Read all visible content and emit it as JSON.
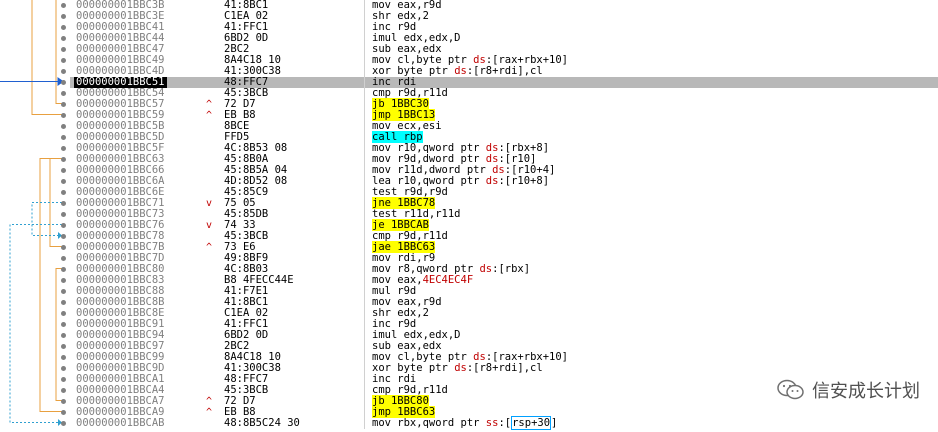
{
  "rows": [
    {
      "addr": "000000001BBC3B",
      "arrow": "",
      "bytes": "41:8BC1",
      "instr": [
        {
          "t": "mov eax,r9d"
        }
      ]
    },
    {
      "addr": "000000001BBC3E",
      "arrow": "",
      "bytes": "C1EA 02",
      "instr": [
        {
          "t": "shr edx,2"
        }
      ]
    },
    {
      "addr": "000000001BBC41",
      "arrow": "",
      "bytes": "41:FFC1",
      "instr": [
        {
          "t": "inc r9d"
        }
      ]
    },
    {
      "addr": "000000001BBC44",
      "arrow": "",
      "bytes": "6BD2 0D",
      "instr": [
        {
          "t": "imul edx,edx,D"
        }
      ]
    },
    {
      "addr": "000000001BBC47",
      "arrow": "",
      "bytes": "2BC2",
      "instr": [
        {
          "t": "sub eax,edx"
        }
      ]
    },
    {
      "addr": "000000001BBC49",
      "arrow": "",
      "bytes": "8A4C18 10",
      "instr": [
        {
          "t": "mov cl,byte ptr "
        },
        {
          "t": "ds",
          "c": "seg"
        },
        {
          "t": ":[rax+rbx+10]"
        }
      ]
    },
    {
      "addr": "000000001BBC4D",
      "arrow": "",
      "bytes": "41:300C38",
      "instr": [
        {
          "t": "xor byte ptr "
        },
        {
          "t": "ds",
          "c": "seg"
        },
        {
          "t": ":[r8+rdi],cl"
        }
      ]
    },
    {
      "addr": "000000001BBC51",
      "arrow": "",
      "bytes": "48:FFC7",
      "instr": [
        {
          "t": "inc rdi"
        }
      ],
      "sel": true,
      "ip": true
    },
    {
      "addr": "000000001BBC54",
      "arrow": "",
      "bytes": "45:3BCB",
      "instr": [
        {
          "t": "cmp r9d,r11d"
        }
      ]
    },
    {
      "addr": "000000001BBC57",
      "arrow": "^",
      "bytes": "72 D7",
      "instr": [
        {
          "t": "jb 1BBC30",
          "c": "hl-y"
        }
      ]
    },
    {
      "addr": "000000001BBC59",
      "arrow": "^",
      "bytes": "EB B8",
      "instr": [
        {
          "t": "jmp 1BBC13",
          "c": "hl-y"
        }
      ]
    },
    {
      "addr": "000000001BBC5B",
      "arrow": "",
      "bytes": "8BCE",
      "instr": [
        {
          "t": "mov ecx,esi"
        }
      ]
    },
    {
      "addr": "000000001BBC5D",
      "arrow": "",
      "bytes": "FFD5",
      "instr": [
        {
          "t": "call rbp",
          "c": "hl-c"
        }
      ]
    },
    {
      "addr": "000000001BBC5F",
      "arrow": "",
      "bytes": "4C:8B53 08",
      "instr": [
        {
          "t": "mov r10,qword ptr "
        },
        {
          "t": "ds",
          "c": "seg"
        },
        {
          "t": ":[rbx+8]"
        }
      ]
    },
    {
      "addr": "000000001BBC63",
      "arrow": "",
      "bytes": "45:8B0A",
      "instr": [
        {
          "t": "mov r9d,dword ptr "
        },
        {
          "t": "ds",
          "c": "seg"
        },
        {
          "t": ":[r10]"
        }
      ]
    },
    {
      "addr": "000000001BBC66",
      "arrow": "",
      "bytes": "45:8B5A 04",
      "instr": [
        {
          "t": "mov r11d,dword ptr "
        },
        {
          "t": "ds",
          "c": "seg"
        },
        {
          "t": ":[r10+4]"
        }
      ]
    },
    {
      "addr": "000000001BBC6A",
      "arrow": "",
      "bytes": "4D:8D52 08",
      "instr": [
        {
          "t": "lea r10,qword ptr "
        },
        {
          "t": "ds",
          "c": "seg"
        },
        {
          "t": ":[r10+8]"
        }
      ]
    },
    {
      "addr": "000000001BBC6E",
      "arrow": "",
      "bytes": "45:85C9",
      "instr": [
        {
          "t": "test r9d,r9d"
        }
      ]
    },
    {
      "addr": "000000001BBC71",
      "arrow": "v",
      "bytes": "75 05",
      "instr": [
        {
          "t": "jne 1BBC78",
          "c": "hl-y"
        }
      ]
    },
    {
      "addr": "000000001BBC73",
      "arrow": "",
      "bytes": "45:85DB",
      "instr": [
        {
          "t": "test r11d,r11d"
        }
      ]
    },
    {
      "addr": "000000001BBC76",
      "arrow": "v",
      "bytes": "74 33",
      "instr": [
        {
          "t": "je 1BBCAB",
          "c": "hl-y"
        }
      ]
    },
    {
      "addr": "000000001BBC78",
      "arrow": "",
      "bytes": "45:3BCB",
      "instr": [
        {
          "t": "cmp r9d,r11d"
        }
      ]
    },
    {
      "addr": "000000001BBC7B",
      "arrow": "^",
      "bytes": "73 E6",
      "instr": [
        {
          "t": "jae 1BBC63",
          "c": "hl-y"
        }
      ]
    },
    {
      "addr": "000000001BBC7D",
      "arrow": "",
      "bytes": "49:8BF9",
      "instr": [
        {
          "t": "mov rdi,r9"
        }
      ]
    },
    {
      "addr": "000000001BBC80",
      "arrow": "",
      "bytes": "4C:8B03",
      "instr": [
        {
          "t": "mov r8,qword ptr "
        },
        {
          "t": "ds",
          "c": "seg"
        },
        {
          "t": ":[rbx]"
        }
      ]
    },
    {
      "addr": "000000001BBC83",
      "arrow": "",
      "bytes": "B8 4FECC44E",
      "instr": [
        {
          "t": "mov eax,"
        },
        {
          "t": "4EC4EC4F",
          "c": "seg"
        }
      ]
    },
    {
      "addr": "000000001BBC88",
      "arrow": "",
      "bytes": "41:F7E1",
      "instr": [
        {
          "t": "mul r9d"
        }
      ]
    },
    {
      "addr": "000000001BBC8B",
      "arrow": "",
      "bytes": "41:8BC1",
      "instr": [
        {
          "t": "mov eax,r9d"
        }
      ]
    },
    {
      "addr": "000000001BBC8E",
      "arrow": "",
      "bytes": "C1EA 02",
      "instr": [
        {
          "t": "shr edx,2"
        }
      ]
    },
    {
      "addr": "000000001BBC91",
      "arrow": "",
      "bytes": "41:FFC1",
      "instr": [
        {
          "t": "inc r9d"
        }
      ]
    },
    {
      "addr": "000000001BBC94",
      "arrow": "",
      "bytes": "6BD2 0D",
      "instr": [
        {
          "t": "imul edx,edx,D"
        }
      ]
    },
    {
      "addr": "000000001BBC97",
      "arrow": "",
      "bytes": "2BC2",
      "instr": [
        {
          "t": "sub eax,edx"
        }
      ]
    },
    {
      "addr": "000000001BBC99",
      "arrow": "",
      "bytes": "8A4C18 10",
      "instr": [
        {
          "t": "mov cl,byte ptr "
        },
        {
          "t": "ds",
          "c": "seg"
        },
        {
          "t": ":[rax+rbx+10]"
        }
      ]
    },
    {
      "addr": "000000001BBC9D",
      "arrow": "",
      "bytes": "41:300C38",
      "instr": [
        {
          "t": "xor byte ptr "
        },
        {
          "t": "ds",
          "c": "seg"
        },
        {
          "t": ":[r8+rdi],cl"
        }
      ]
    },
    {
      "addr": "000000001BBCA1",
      "arrow": "",
      "bytes": "48:FFC7",
      "instr": [
        {
          "t": "inc rdi"
        }
      ]
    },
    {
      "addr": "000000001BBCA4",
      "arrow": "",
      "bytes": "45:3BCB",
      "instr": [
        {
          "t": "cmp r9d,r11d"
        }
      ]
    },
    {
      "addr": "000000001BBCA7",
      "arrow": "^",
      "bytes": "72 D7",
      "instr": [
        {
          "t": "jb 1BBC80",
          "c": "hl-y"
        }
      ]
    },
    {
      "addr": "000000001BBCA9",
      "arrow": "^",
      "bytes": "EB B8",
      "instr": [
        {
          "t": "jmp 1BBC63",
          "c": "hl-y"
        }
      ]
    },
    {
      "addr": "000000001BBCAB",
      "arrow": "",
      "bytes": "48:8B5C24 30",
      "instr": [
        {
          "t": "mov rbx,qword ptr "
        },
        {
          "t": "ss",
          "c": "seg"
        },
        {
          "t": ":["
        },
        {
          "t": "rsp+30",
          "c": "cursorbox"
        },
        {
          "t": "]"
        }
      ]
    }
  ],
  "watermark": {
    "text": "信安成长计划",
    "icon": "wechat-icon"
  },
  "colors": {
    "orange_branch": "#e8a040",
    "blue_branch": "#2060d0",
    "dashed_branch": "#30a0d0",
    "highlight_yellow": "#ffff00",
    "highlight_cyan": "#00ffff"
  }
}
